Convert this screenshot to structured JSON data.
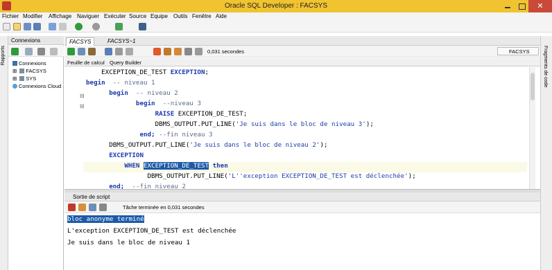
{
  "window": {
    "title": "Oracle SQL Developer : FACSYS",
    "close": "✕"
  },
  "menu": [
    "Fichier",
    "Modifier",
    "Affichage",
    "Naviguer",
    "Exécuter",
    "Source",
    "Equipe",
    "Outils",
    "Fenêtre",
    "Aide"
  ],
  "left_strip": {
    "label": "Rapports"
  },
  "right_strip": {
    "label": "Fragments de code"
  },
  "connections_panel": {
    "tab_label": "Connexions",
    "tree": [
      {
        "label": "Connexions",
        "level": 0
      },
      {
        "label": "FACSYS",
        "level": 1
      },
      {
        "label": "SYS",
        "level": 1
      },
      {
        "label": "Connexions Cloud",
        "level": 0
      }
    ]
  },
  "editor": {
    "tabs": [
      "FACSYS",
      "FACSYS~1"
    ],
    "exec_time": "0,031 secondes",
    "connection_select": "FACSYS",
    "subtabs": [
      "Feuille de calcul",
      "Query Builder"
    ],
    "lines": [
      [
        {
          "t": "    EXCEPTION_DE_TEST "
        },
        {
          "t": "EXCEPTION",
          "c": "kw"
        },
        {
          "t": ";"
        }
      ],
      [
        {
          "t": "begin",
          "c": "kw"
        },
        {
          "t": "  -- niveau 1",
          "c": "cm"
        }
      ],
      [
        {
          "t": "      "
        },
        {
          "t": "begin",
          "c": "kw"
        },
        {
          "t": "  -- niveau 2",
          "c": "cm"
        }
      ],
      [
        {
          "t": "             "
        },
        {
          "t": "begin",
          "c": "kw"
        },
        {
          "t": "  --niveau 3",
          "c": "cm"
        }
      ],
      [
        {
          "t": "                  "
        },
        {
          "t": "RAISE",
          "c": "kw"
        },
        {
          "t": " EXCEPTION_DE_TEST;"
        }
      ],
      [
        {
          "t": "                  DBMS_OUTPUT.PUT_LINE("
        },
        {
          "t": "'Je suis dans le bloc de niveau 3'",
          "c": "str"
        },
        {
          "t": ");"
        }
      ],
      [
        {
          "t": "              "
        },
        {
          "t": "end;",
          "c": "kw"
        },
        {
          "t": " --fin niveau 3",
          "c": "cm"
        }
      ],
      [
        {
          "t": "      DBMS_OUTPUT.PUT_LINE("
        },
        {
          "t": "'Je suis dans le bloc de niveau 2'",
          "c": "str"
        },
        {
          "t": ");"
        }
      ],
      [
        {
          "t": "      "
        },
        {
          "t": "EXCEPTION",
          "c": "kw"
        }
      ],
      [
        {
          "t": "          "
        },
        {
          "t": "WHEN",
          "c": "kw"
        },
        {
          "t": " "
        },
        {
          "t": "EXCEPTION_DE_TEST",
          "c": "hl"
        },
        {
          "t": " "
        },
        {
          "t": "then",
          "c": "kw"
        }
      ],
      [
        {
          "t": "                DBMS_OUTPUT.PUT_LINE("
        },
        {
          "t": "'L''exception EXCEPTION_DE_TEST est déclenchée'",
          "c": "str"
        },
        {
          "t": ");"
        }
      ],
      [
        {
          "t": "      "
        },
        {
          "t": "end;",
          "c": "kw"
        },
        {
          "t": "  --fin niveau 2",
          "c": "cm"
        }
      ]
    ]
  },
  "script_output": {
    "tab_label": "Sortie de script",
    "status": "Tâche terminée en 0,031 secondes",
    "lines": [
      "bloc anonyme terminé",
      "L'exception EXCEPTION_DE_TEST est déclenchée",
      "Je suis dans le bloc de niveau 1"
    ]
  },
  "colors": {
    "titlebar": "#f0c330",
    "keyword": "#1a3ab0",
    "selection": "#1d5aa8",
    "current_line": "#fbfae6"
  }
}
